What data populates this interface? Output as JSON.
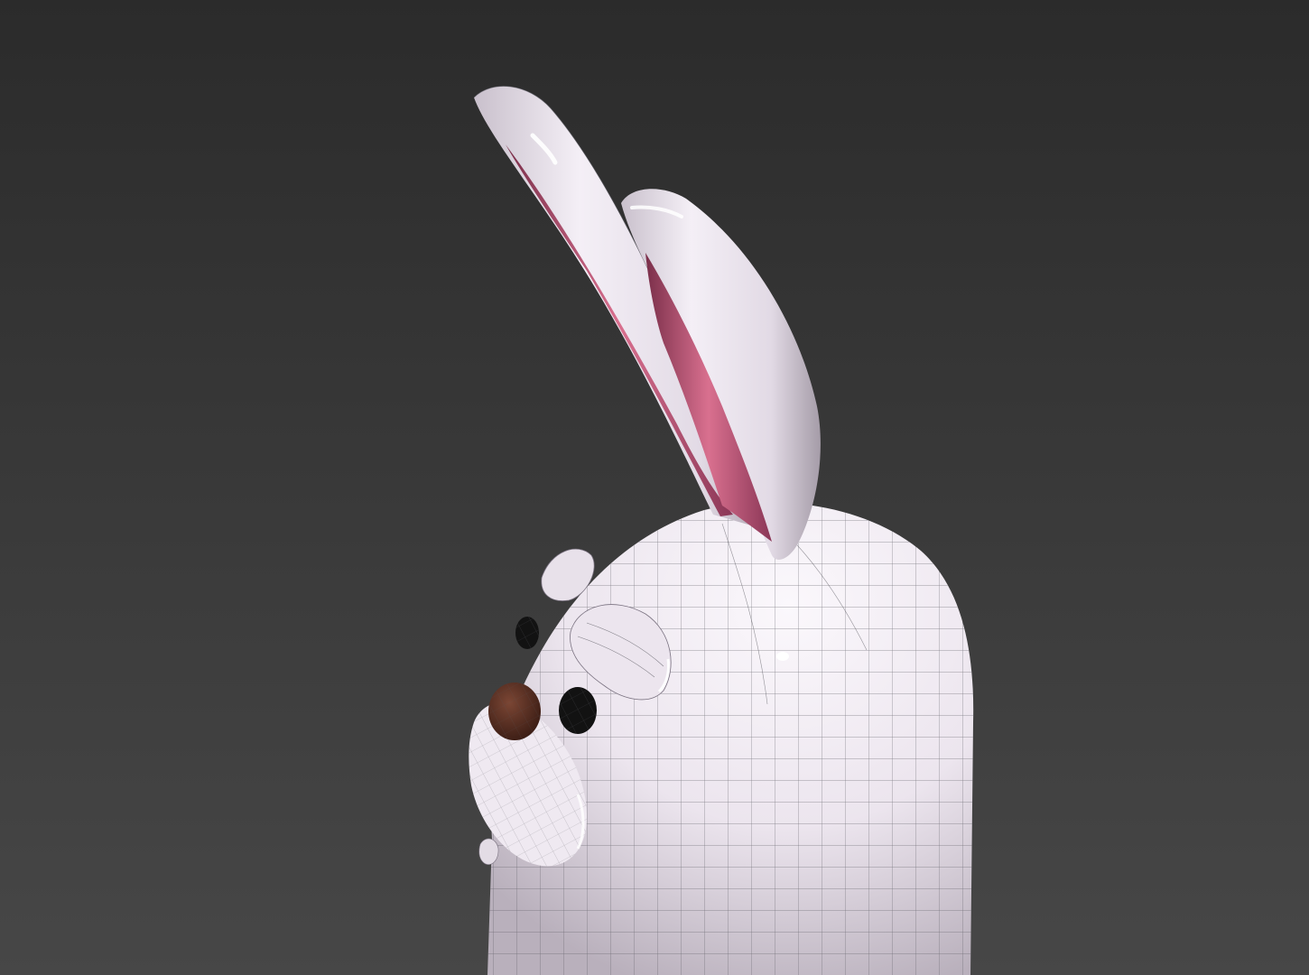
{
  "viewport": {
    "background_top": "#2b2b2b",
    "background_bottom": "#474747",
    "shading_mode": "smooth-wireframe"
  },
  "model": {
    "subject": "bunny-character",
    "body_color": "#efe9f1",
    "shadow_color": "#a79ea9",
    "inner_ear_color": "#cf6a8c",
    "nose_color": "#5a2f22",
    "eye_color": "#121212",
    "wire_color": "#4a4a50"
  }
}
